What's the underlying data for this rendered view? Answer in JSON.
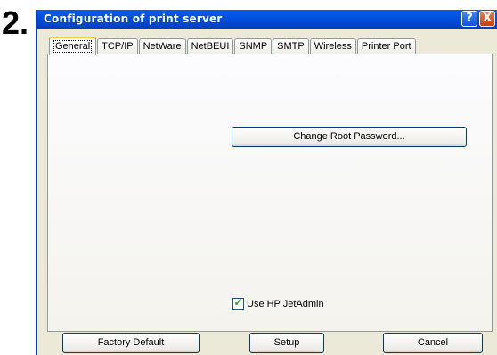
{
  "step_number": "2.",
  "window": {
    "title": "Configuration of print server",
    "help_label": "?",
    "close_label": "X"
  },
  "tabs": [
    "General",
    "TCP/IP",
    "NetWare",
    "NetBEUI",
    "SNMP",
    "SMTP",
    "Wireless",
    "Printer Port"
  ],
  "general": {
    "change_password_label": "Change Root Password...",
    "use_jetadmin_label": "Use HP JetAdmin",
    "use_jetadmin_checked": true
  },
  "footer": {
    "factory_default_label": "Factory Default",
    "setup_label": "Setup",
    "cancel_label": "Cancel"
  }
}
